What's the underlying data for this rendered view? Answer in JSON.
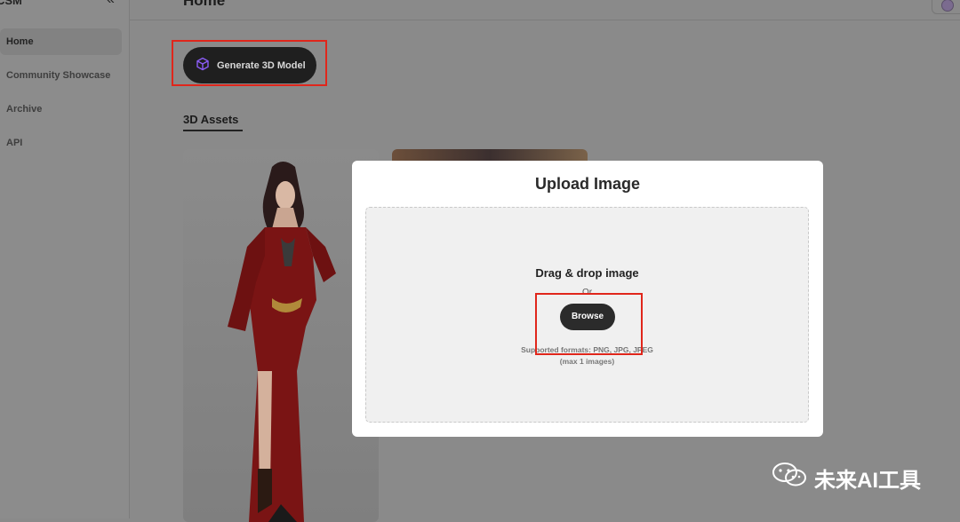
{
  "sidebar": {
    "brand": "CSM",
    "collapse_icon": "«",
    "items": [
      {
        "label": "Home",
        "active": true
      },
      {
        "label": "Community Showcase"
      },
      {
        "label": "Archive"
      },
      {
        "label": "API"
      }
    ]
  },
  "header": {
    "title": "Home"
  },
  "main": {
    "generate_button": {
      "label": "Generate 3D Model",
      "icon": "cube-icon"
    },
    "section_title": "3D Assets"
  },
  "modal": {
    "title": "Upload Image",
    "dropzone": {
      "main_text": "Drag & drop image",
      "or_text": "Or",
      "browse_label": "Browse",
      "formats": "Supported formats: PNG, JPG, JPEG",
      "limit": "(max 1 images)"
    }
  },
  "watermark": {
    "text": "未来AI工具",
    "icon": "wechat-icon"
  },
  "colors": {
    "highlight": "#e0261b",
    "accent": "#8b5cf6"
  }
}
